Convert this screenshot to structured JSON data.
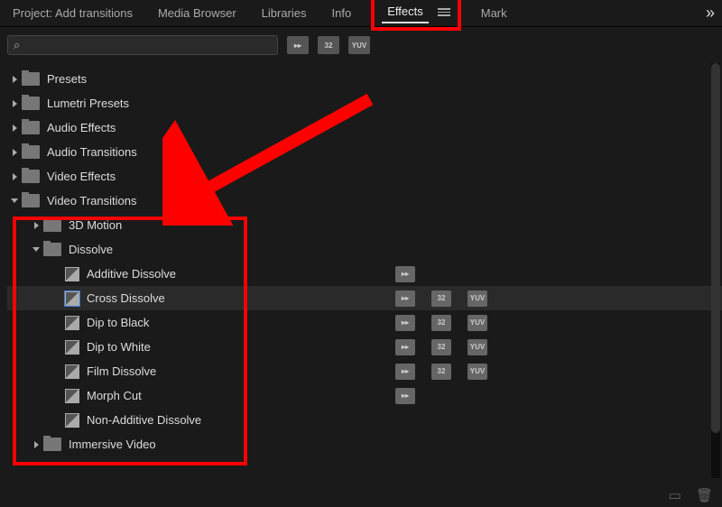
{
  "tabs": {
    "project": "Project: Add transitions",
    "media_browser": "Media Browser",
    "libraries": "Libraries",
    "info": "Info",
    "effects": "Effects",
    "markers": "Mark",
    "overflow": "»"
  },
  "search": {
    "placeholder": ""
  },
  "filter_badges": {
    "accelerated": "▸▸",
    "b32": "32",
    "yuv": "YUV"
  },
  "tree": {
    "presets": "Presets",
    "lumetri_presets": "Lumetri Presets",
    "audio_effects": "Audio Effects",
    "audio_transitions": "Audio Transitions",
    "video_effects": "Video Effects",
    "video_transitions": "Video Transitions",
    "vt": {
      "motion3d": "3D Motion",
      "dissolve": "Dissolve",
      "dissolve_items": {
        "additive": "Additive Dissolve",
        "cross": "Cross Dissolve",
        "dip_black": "Dip to Black",
        "dip_white": "Dip to White",
        "film": "Film Dissolve",
        "morph": "Morph Cut",
        "non_additive": "Non-Additive Dissolve"
      },
      "immersive": "Immersive Video"
    }
  },
  "row_badges": {
    "additive": {
      "acc": true,
      "b32": false,
      "yuv": false
    },
    "cross": {
      "acc": true,
      "b32": true,
      "yuv": true
    },
    "dip_black": {
      "acc": true,
      "b32": true,
      "yuv": true
    },
    "dip_white": {
      "acc": true,
      "b32": true,
      "yuv": true
    },
    "film": {
      "acc": true,
      "b32": true,
      "yuv": true
    },
    "morph": {
      "acc": true,
      "b32": false,
      "yuv": false
    },
    "non_additive": {
      "acc": false,
      "b32": false,
      "yuv": false
    }
  },
  "colors": {
    "highlight": "#ff0000"
  }
}
